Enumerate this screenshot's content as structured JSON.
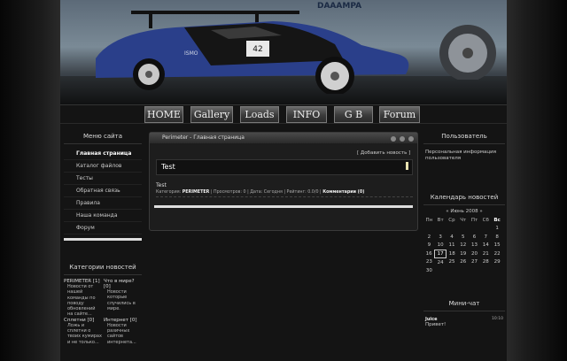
{
  "header": {
    "banner_text_1": "DAAAMPA",
    "banner_text_2": "ISMO"
  },
  "nav": {
    "items": [
      "HOME",
      "Gallery",
      "Loads",
      "INFO",
      "G B",
      "Forum"
    ]
  },
  "left_menu": {
    "title": "Меню сайта",
    "items": [
      "Главная страница",
      "Каталог файлов",
      "Тесты",
      "Обратная связь",
      "Правила",
      "Наша команда",
      "Форум"
    ]
  },
  "categories": {
    "title": "Категории новостей",
    "items": [
      {
        "name": "PERIMETER [1]",
        "desc": "Новости от нашей команды по поводу обновлений на сайте..."
      },
      {
        "name": "Что в мире? [0]",
        "desc": "Новости которые случились в мире."
      },
      {
        "name": "Сплетни [0]",
        "desc": "Ложь и сплетни о твоих кумирах и не только..."
      },
      {
        "name": "Интернет [0]",
        "desc": "Новости разичных сайтов интернета..."
      }
    ]
  },
  "window": {
    "title": "Perimeter - Главная страница",
    "add_news": "[ Добавить новость ]"
  },
  "news": {
    "title": "Test",
    "body": "Test",
    "meta_category_label": "Категория:",
    "meta_category": "PERIMETER",
    "meta_rest": "| Просмотров: 0 | Дата: Сегодня | Рейтинг: 0.0/0 |",
    "meta_comments": "Комментарии (0)"
  },
  "user": {
    "title": "Пользователь",
    "info": "Персональная информация пользователя"
  },
  "calendar": {
    "title": "Календарь новостей",
    "month_nav": "«  Июнь 2008  »",
    "weekdays": [
      "Пн",
      "Вт",
      "Ср",
      "Чт",
      "Пт",
      "Сб",
      "Вс"
    ],
    "weeks": [
      [
        "",
        "",
        "",
        "",
        "",
        "",
        "1"
      ],
      [
        "2",
        "3",
        "4",
        "5",
        "6",
        "7",
        "8"
      ],
      [
        "9",
        "10",
        "11",
        "12",
        "13",
        "14",
        "15"
      ],
      [
        "16",
        "17",
        "18",
        "19",
        "20",
        "21",
        "22"
      ],
      [
        "23",
        "24",
        "25",
        "26",
        "27",
        "28",
        "29"
      ],
      [
        "30",
        "",
        "",
        "",
        "",
        "",
        ""
      ]
    ],
    "today": "17"
  },
  "chat": {
    "title": "Мини-чат",
    "user": "Juice",
    "time": "10:10",
    "message": "Привет!"
  },
  "colors": {
    "background": "#1a1a1a",
    "car_blue": "#2a3f8a",
    "text": "#cccccc"
  }
}
